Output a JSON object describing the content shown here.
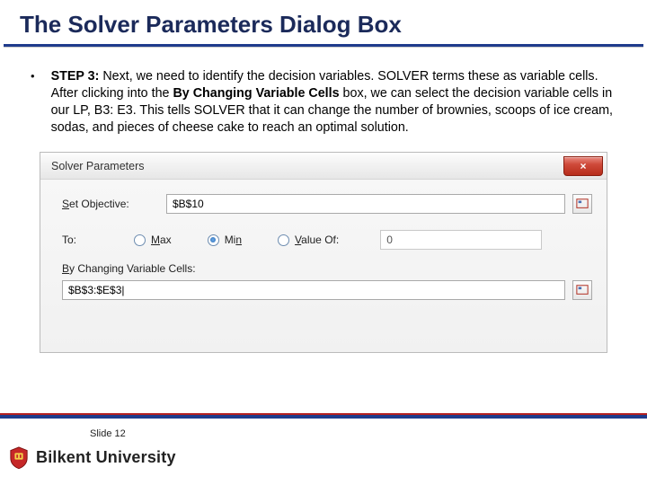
{
  "slide": {
    "title": "The Solver Parameters Dialog Box",
    "bullet": "•",
    "step_label": "STEP 3:",
    "step_text_1": " Next, we need to identify the decision variables. SOLVER terms these as variable cells. After clicking into the ",
    "bold_1": "By Changing Variable Cells",
    "step_text_2": " box, we can select the decision variable cells in our LP, B3: E3. This tells SOLVER that it can change the number of brownies, scoops of ice cream, sodas, and pieces of cheese cake to reach an optimal solution.",
    "slide_number": "Slide 12",
    "university": "Bilkent University"
  },
  "dialog": {
    "title": "Solver Parameters",
    "close_glyph": "×",
    "set_objective_label": "Set Objective:",
    "set_objective_value": "$B$10",
    "to_label": "To:",
    "opt_max": "Max",
    "opt_min": "Min",
    "opt_valueof": "Value Of:",
    "valueof_value": "0",
    "changing_label": "By Changing Variable Cells:",
    "changing_value": "$B$3:$E$3|"
  }
}
